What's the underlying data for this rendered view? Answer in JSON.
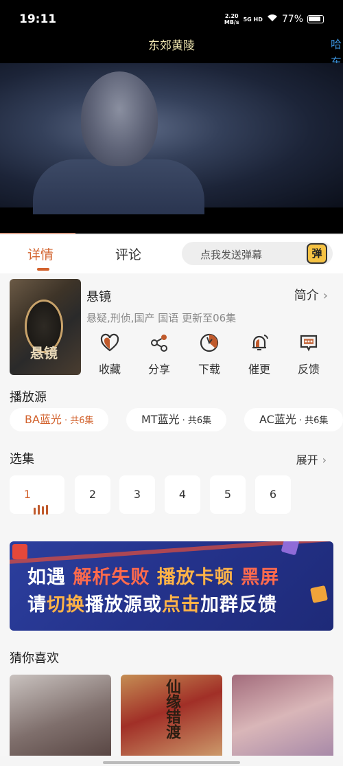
{
  "status_bar": {
    "time": "19:11",
    "net_speed": "2.20",
    "net_unit": "MB/s",
    "signal": "5G HD",
    "battery": "77%"
  },
  "player": {
    "title": "东郊黄陵",
    "danmaku_chars": [
      "哈",
      "东"
    ]
  },
  "tabs": {
    "detail": "详情",
    "comment": "评论",
    "danmaku_placeholder": "点我发送弹幕",
    "danmaku_button": "弹"
  },
  "show": {
    "title": "悬镜",
    "intro_link": "简介",
    "meta": "悬疑,刑侦,国产 国语 更新至06集",
    "poster_mark": "悬镜"
  },
  "actions": [
    {
      "label": "收藏",
      "icon": "heart-icon"
    },
    {
      "label": "分享",
      "icon": "share-icon"
    },
    {
      "label": "下载",
      "icon": "download-icon"
    },
    {
      "label": "催更",
      "icon": "bell-icon"
    },
    {
      "label": "反馈",
      "icon": "feedback-icon"
    }
  ],
  "sources": {
    "label": "播放源",
    "items": [
      {
        "name": "BA蓝光",
        "count": "· 共6集"
      },
      {
        "name": "MT蓝光",
        "count": "· 共6集"
      },
      {
        "name": "AC蓝光",
        "count": "· 共6集"
      }
    ]
  },
  "episodes": {
    "label": "选集",
    "expand": "展开",
    "items": [
      "1",
      "2",
      "3",
      "4",
      "5",
      "6"
    ]
  },
  "banner": {
    "line1_a": "如遇",
    "line1_b": "解析失败",
    "line1_c": "播放卡顿",
    "line1_d": "黑屏",
    "line2_a": "请",
    "line2_b": "切换",
    "line2_c": "播放源或",
    "line2_d": "点击",
    "line2_e": "加群反馈"
  },
  "guess": {
    "label": "猜你喜欢",
    "rec2_title": "仙缘错渡"
  },
  "colors": {
    "accent": "#d2622d",
    "banner_bg": "#24328a"
  }
}
